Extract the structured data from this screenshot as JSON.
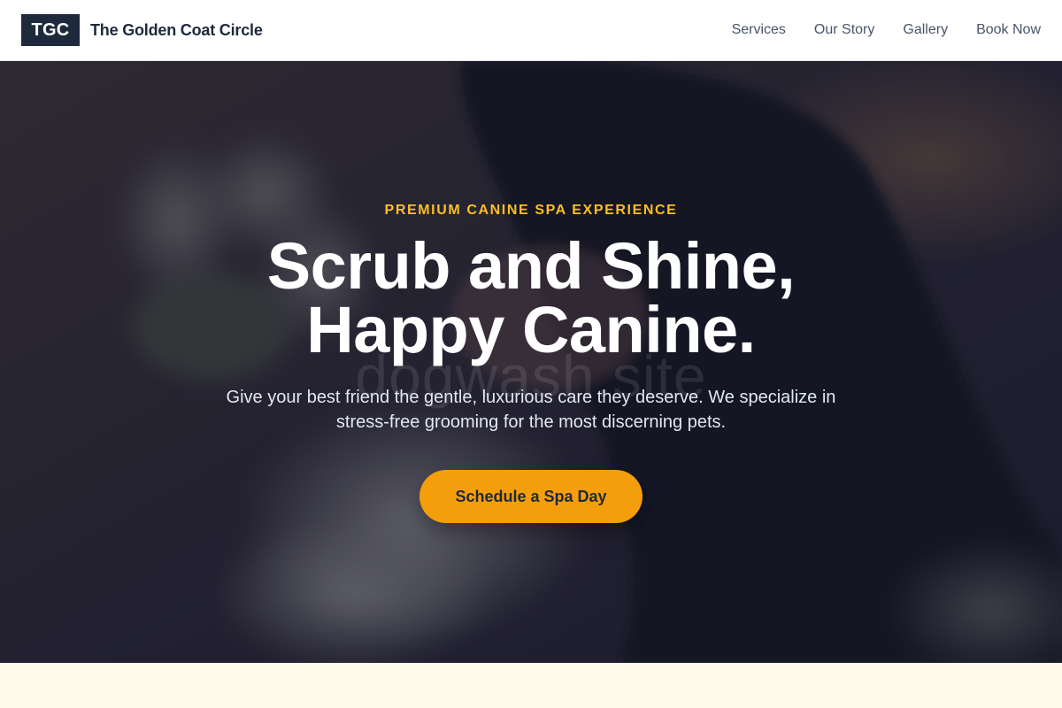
{
  "header": {
    "logo_text": "TGC",
    "brand_name": "The Golden Coat Circle",
    "nav": [
      {
        "label": "Services"
      },
      {
        "label": "Our Story"
      },
      {
        "label": "Gallery"
      },
      {
        "label": "Book Now"
      }
    ]
  },
  "hero": {
    "eyebrow": "PREMIUM CANINE SPA EXPERIENCE",
    "headline_line1": "Scrub and Shine,",
    "headline_line2": "Happy Canine.",
    "subtext": "Give your best friend the gentle, luxurious care they deserve. We specialize in stress-free grooming for the most discerning pets.",
    "cta_label": "Schedule a Spa Day",
    "watermark": "dogwash.site"
  },
  "colors": {
    "brand_dark": "#1e293b",
    "accent": "#f59e0b",
    "eyebrow": "#fbbf24",
    "section_bg": "#fffbeb"
  }
}
